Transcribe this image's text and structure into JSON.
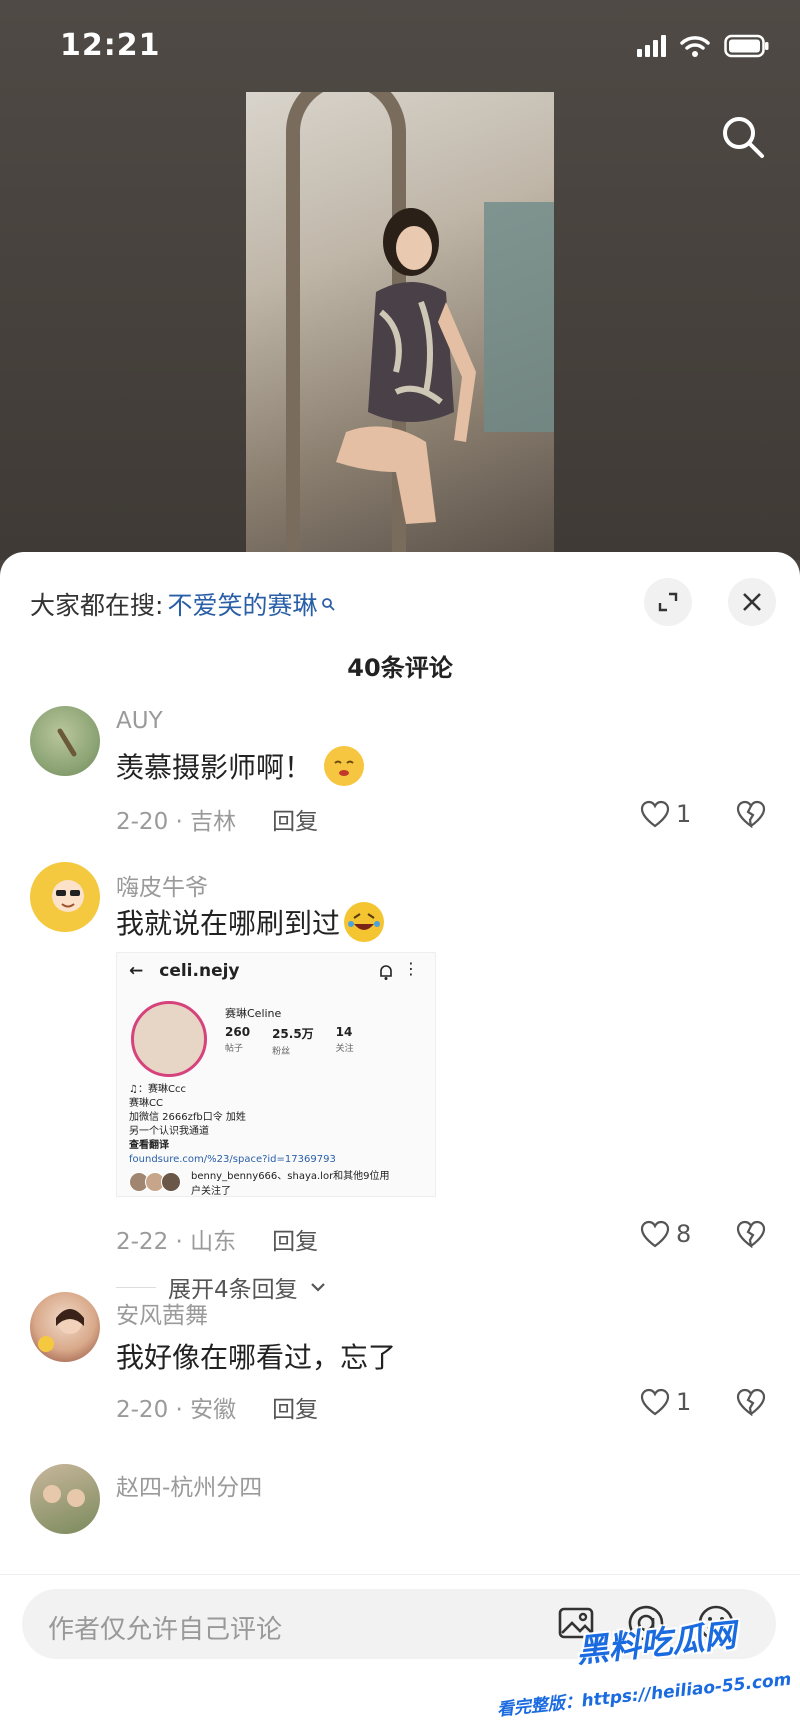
{
  "status_bar": {
    "time": "12:21"
  },
  "sheet": {
    "hot_search_prefix": "大家都在搜:",
    "hot_search_keyword": "不爱笑的赛琳",
    "comment_count": "40条评论"
  },
  "comments": [
    {
      "username": "AUY",
      "text": "羡慕摄影师啊！",
      "emoji": "smiling-face-emoji",
      "date_location": "2-20 · 吉林",
      "reply_label": "回复",
      "likes": "1"
    },
    {
      "username": "嗨皮牛爷",
      "text": "我就说在哪刷到过",
      "emoji": "rolling-on-floor-laughing-emoji",
      "date_location": "2-22 · 山东",
      "reply_label": "回复",
      "likes": "8",
      "expand_label": "展开4条回复",
      "image": {
        "handle": "celi.nejy",
        "display_name": "赛琳Celine",
        "stats": [
          {
            "value": "260",
            "label": "帖子"
          },
          {
            "value": "25.5万",
            "label": "粉丝"
          },
          {
            "value": "14",
            "label": "关注"
          }
        ],
        "bio_lines": [
          "♫：赛琳Ccc",
          "赛琳CC",
          "加微信 2666zfb口令 加姓",
          "另一个认识我通道"
        ],
        "see_translation": "查看翻译",
        "link": "foundsure.com/%23/space?id=17369793",
        "followed_by": "benny_benny666、shaya.lor和其他9位用户关注了"
      }
    },
    {
      "username": "安风茜舞",
      "text": "我好像在哪看过，忘了",
      "date_location": "2-20 · 安徽",
      "reply_label": "回复",
      "likes": "1"
    },
    {
      "username": "赵四-杭州分四"
    }
  ],
  "input_bar": {
    "placeholder": "作者仅允许自己评论"
  },
  "watermark": {
    "title": "黑料吃瓜网",
    "url": "看完整版：https://heiliao-55.com"
  },
  "colors": {
    "accent_link": "#2a5fa8",
    "video_bg": "#4a4540",
    "watermark": "#1a6be0"
  }
}
